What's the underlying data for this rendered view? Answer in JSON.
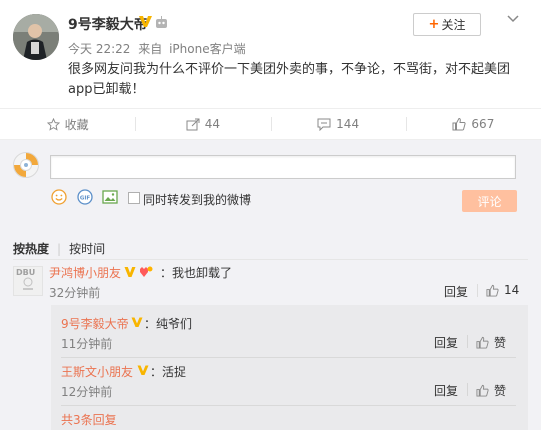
{
  "post": {
    "author": "9号李毅大帝",
    "time": "今天 22:22",
    "source_prefix": "来自",
    "source": "iPhone客户端",
    "text": "很多网友问我为什么不评价一下美团外卖的事，不争论，不骂街，对不起美团app已卸载！",
    "follow_label": "关注"
  },
  "actions": {
    "favorite_label": "收藏",
    "repost_count": "44",
    "comment_count": "144",
    "like_count": "667"
  },
  "composer": {
    "repost_option": "同时转发到我的微博",
    "submit_label": "评论"
  },
  "sort": {
    "hot": "按热度",
    "time": "按时间"
  },
  "comment": {
    "avatar_text": "DBU",
    "author": "尹鸿博小朋友",
    "text": "：我也卸载了",
    "time": "32分钟前",
    "reply_label": "回复",
    "like_count": "14"
  },
  "sub_replies": [
    {
      "author": "9号李毅大帝",
      "text": "：纯爷们",
      "time": "11分钟前",
      "reply_label": "回复",
      "like_label": "赞"
    },
    {
      "author": "王斯文小朋友",
      "text": "：活捉",
      "time": "12分钟前",
      "reply_label": "回复",
      "like_label": "赞"
    }
  ],
  "more_replies": "共3条回复",
  "colors": {
    "accent": "#eb7350",
    "vip_badge": "#f8b500",
    "submit_disabled": "#ffc09f",
    "follow_plus": "#ff6600"
  },
  "icons": [
    "star-icon",
    "repost-icon",
    "comment-icon",
    "like-icon",
    "emoji-icon",
    "gif-icon",
    "image-icon",
    "chevron-down-icon"
  ]
}
